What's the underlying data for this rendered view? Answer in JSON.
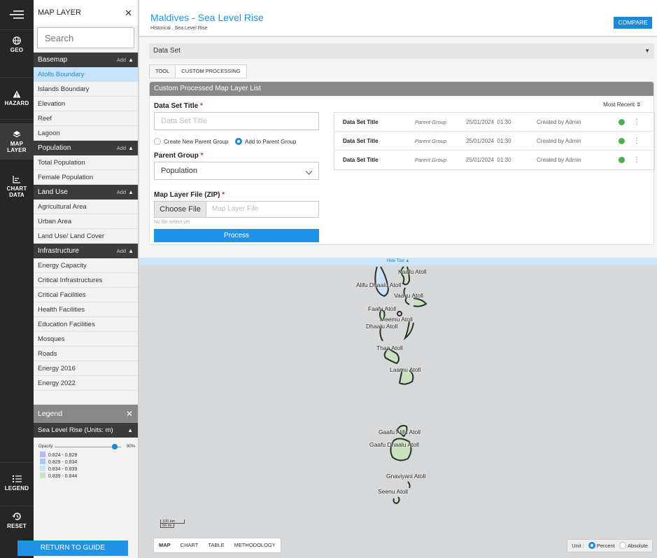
{
  "rail": {
    "geo": "GEO",
    "hazard": "HAZARD",
    "map_layer_1": "MAP",
    "map_layer_2": "LAYER",
    "chart_data_1": "CHART",
    "chart_data_2": "DATA",
    "legend": "LEGEND",
    "reset": "RESET"
  },
  "panel": {
    "title": "MAP LAYER",
    "close": "✕",
    "search_placeholder": "Search",
    "add_label": "Add",
    "groups": [
      {
        "label": "Basemap",
        "items": [
          "Atolls Boundary",
          "Islands Boundary",
          "Elevation",
          "Reef",
          "Lagoon"
        ]
      },
      {
        "label": "Population",
        "items": [
          "Total Population",
          "Female Population"
        ]
      },
      {
        "label": "Land Use",
        "items": [
          "Agricultural Area",
          "Urban Area",
          "Land Use/ Land Cover"
        ]
      },
      {
        "label": "Infrastructure",
        "items": [
          "Energy Capacity",
          "Critical Infrastructures",
          "Critical Facilities",
          "Health Facilities",
          "Education Facilities",
          "Mosques",
          "Roads",
          "Energy 2016",
          "Energy 2022"
        ]
      }
    ],
    "selected_item": "Atolls Boundary"
  },
  "legend": {
    "title": "Legend",
    "layer": "Sea Level Rise (Units: m)",
    "opacity_label": "Opacity",
    "opacity_value": "90%",
    "opacity_fraction": 0.9,
    "rows": [
      {
        "label": "0.824 - 0.829",
        "color": "#b3b8f0"
      },
      {
        "label": "0.829 - 0.834",
        "color": "#a8c8f5"
      },
      {
        "label": "0.834 - 0.839",
        "color": "#c8e6f7"
      },
      {
        "label": "0.839 - 0.844",
        "color": "#c8e3bd"
      }
    ]
  },
  "return_button": "RETURN TO GUIDE",
  "header": {
    "title": "Maldives - Sea Level Rise",
    "subtitle": "Historical , Sea Level Rise",
    "compare": "COMPARE"
  },
  "dataset": {
    "label": "Data Set"
  },
  "tabs": [
    {
      "label": "TOOL"
    },
    {
      "label": "CUSTOM PROCESSING"
    }
  ],
  "form": {
    "card_title": "Custom Processed Map Layer List",
    "title_label": "Data Set Title",
    "title_placeholder": "Data Set Title",
    "radio_new": "Create New Parent Group",
    "radio_add": "Add to Parent Group",
    "parent_label": "Parent Group",
    "parent_value": "Population",
    "file_label": "Map Layer File (ZIP)",
    "choose_file": "Choose File",
    "file_placeholder": "Map Layer File",
    "no_file": "No file select yet",
    "process": "Process",
    "required_mark": "*"
  },
  "list": {
    "sort_label": "Most Recent",
    "rows": [
      {
        "title": "Data Set Title",
        "group": "Parent Group",
        "date": "25/01/2024",
        "time": "01:30",
        "creator": "Created by Admin"
      },
      {
        "title": "Data Set Title",
        "group": "Parent Group",
        "date": "25/01/2024",
        "time": "01:30",
        "creator": "Created by Admin"
      },
      {
        "title": "Data Set Title",
        "group": "Parent Group",
        "date": "25/01/2024",
        "time": "01:30",
        "creator": "Created by Admin"
      }
    ]
  },
  "hide_tool": "Hide Tool",
  "map": {
    "labels": [
      "Kaafu Atoll",
      "Alifu Dhaalu Atoll",
      "Vaavu Atoll",
      "Faafu Atoll",
      "Meemu Atoll",
      "Dhaalu Atoll",
      "Thaa Atoll",
      "Laamu Atoll",
      "Gaafu Alifu Atoll",
      "Gaafu Dhaalu Atoll",
      "Gnaviyani Atoll",
      "Seenu Atoll"
    ],
    "scale_km": "100 km",
    "scale_mi": "50 mi",
    "view_tabs": [
      "MAP",
      "CHART",
      "TABLE",
      "METHODOLOGY"
    ],
    "unit_label": "Unit :",
    "unit_percent": "Percent",
    "unit_absolute": "Absolute",
    "colors": {
      "land_fill": "#c8e3bd",
      "land_stroke": "#2d2d2d",
      "water_fill": "#cde2f5"
    }
  }
}
